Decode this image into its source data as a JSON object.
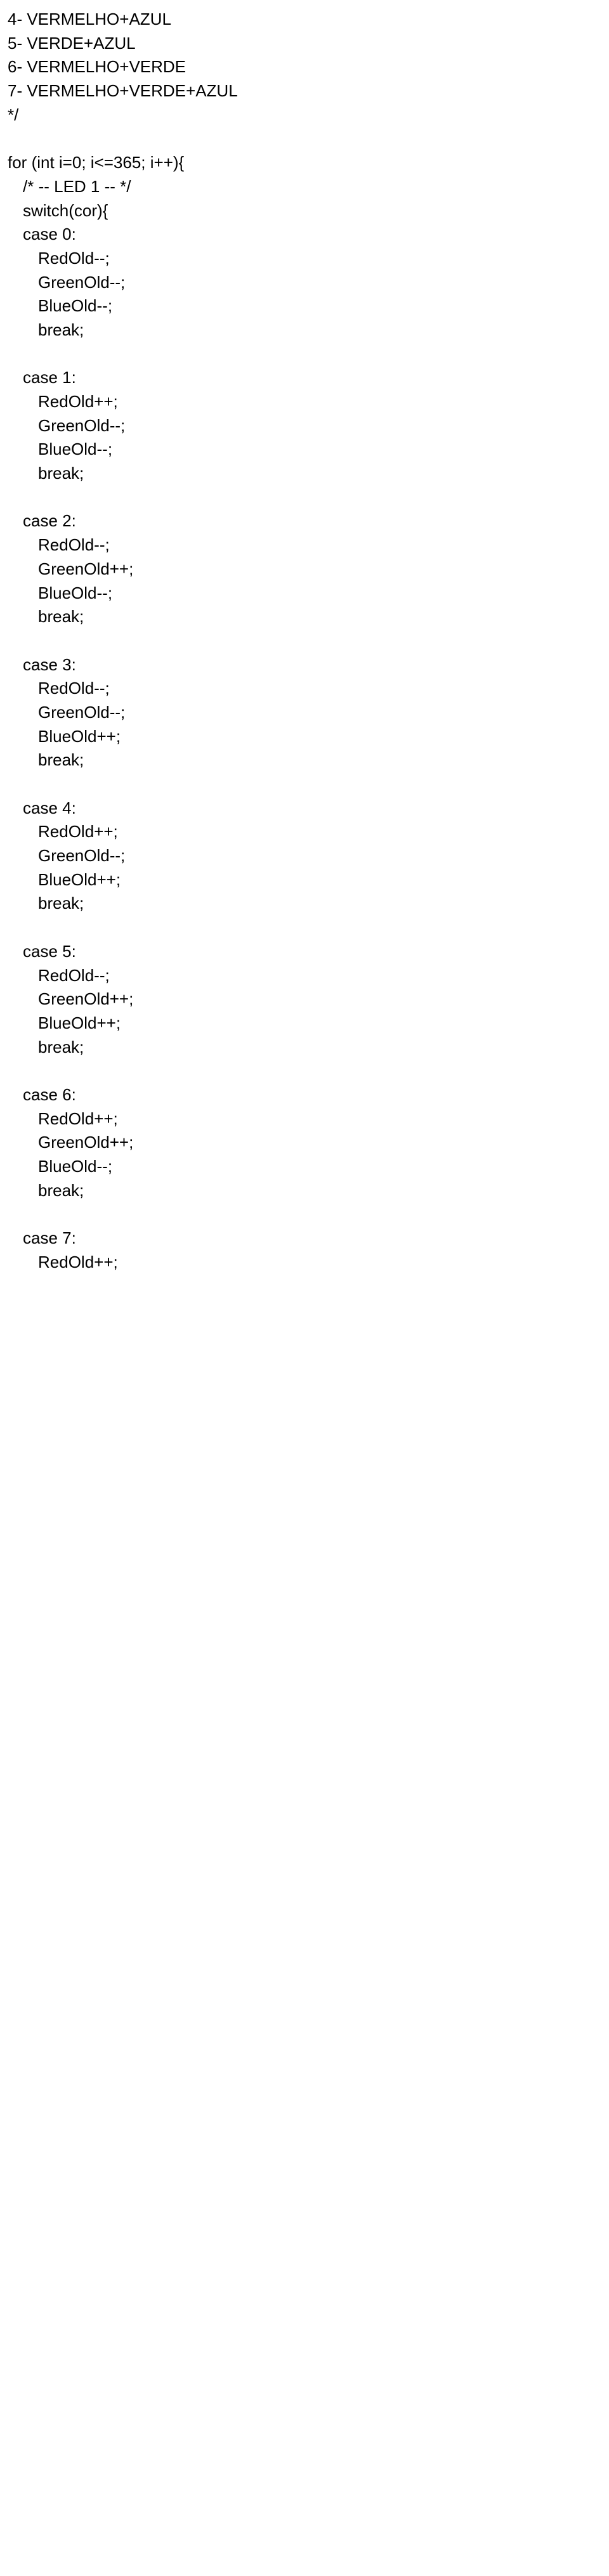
{
  "lines": [
    {
      "indent": 0,
      "text": "4- VERMELHO+AZUL"
    },
    {
      "indent": 0,
      "text": "5- VERDE+AZUL"
    },
    {
      "indent": 0,
      "text": "6- VERMELHO+VERDE"
    },
    {
      "indent": 0,
      "text": "7- VERMELHO+VERDE+AZUL"
    },
    {
      "indent": 0,
      "text": "*/"
    },
    {
      "indent": 0,
      "text": ""
    },
    {
      "indent": 0,
      "text": "for (int i=0; i<=365; i++){"
    },
    {
      "indent": 1,
      "text": "/* -- LED 1 -- */"
    },
    {
      "indent": 1,
      "text": "switch(cor){"
    },
    {
      "indent": 1,
      "text": "case 0:"
    },
    {
      "indent": 2,
      "text": "RedOld--;"
    },
    {
      "indent": 2,
      "text": "GreenOld--;"
    },
    {
      "indent": 2,
      "text": "BlueOld--;"
    },
    {
      "indent": 2,
      "text": "break;"
    },
    {
      "indent": 0,
      "text": ""
    },
    {
      "indent": 1,
      "text": "case 1:"
    },
    {
      "indent": 2,
      "text": "RedOld++;"
    },
    {
      "indent": 2,
      "text": "GreenOld--;"
    },
    {
      "indent": 2,
      "text": "BlueOld--;"
    },
    {
      "indent": 2,
      "text": "break;"
    },
    {
      "indent": 0,
      "text": ""
    },
    {
      "indent": 1,
      "text": "case 2:"
    },
    {
      "indent": 2,
      "text": "RedOld--;"
    },
    {
      "indent": 2,
      "text": "GreenOld++;"
    },
    {
      "indent": 2,
      "text": "BlueOld--;"
    },
    {
      "indent": 2,
      "text": "break;"
    },
    {
      "indent": 0,
      "text": ""
    },
    {
      "indent": 1,
      "text": "case 3:"
    },
    {
      "indent": 2,
      "text": "RedOld--;"
    },
    {
      "indent": 2,
      "text": "GreenOld--;"
    },
    {
      "indent": 2,
      "text": "BlueOld++;"
    },
    {
      "indent": 2,
      "text": "break;"
    },
    {
      "indent": 0,
      "text": ""
    },
    {
      "indent": 1,
      "text": "case 4:"
    },
    {
      "indent": 2,
      "text": "RedOld++;"
    },
    {
      "indent": 2,
      "text": "GreenOld--;"
    },
    {
      "indent": 2,
      "text": "BlueOld++;"
    },
    {
      "indent": 2,
      "text": "break;"
    },
    {
      "indent": 0,
      "text": ""
    },
    {
      "indent": 1,
      "text": "case 5:"
    },
    {
      "indent": 2,
      "text": "RedOld--;"
    },
    {
      "indent": 2,
      "text": "GreenOld++;"
    },
    {
      "indent": 2,
      "text": "BlueOld++;"
    },
    {
      "indent": 2,
      "text": "break;"
    },
    {
      "indent": 0,
      "text": ""
    },
    {
      "indent": 1,
      "text": "case 6:"
    },
    {
      "indent": 2,
      "text": "RedOld++;"
    },
    {
      "indent": 2,
      "text": "GreenOld++;"
    },
    {
      "indent": 2,
      "text": "BlueOld--;"
    },
    {
      "indent": 2,
      "text": "break;"
    },
    {
      "indent": 0,
      "text": ""
    },
    {
      "indent": 1,
      "text": "case 7:"
    },
    {
      "indent": 2,
      "text": "RedOld++;"
    }
  ]
}
